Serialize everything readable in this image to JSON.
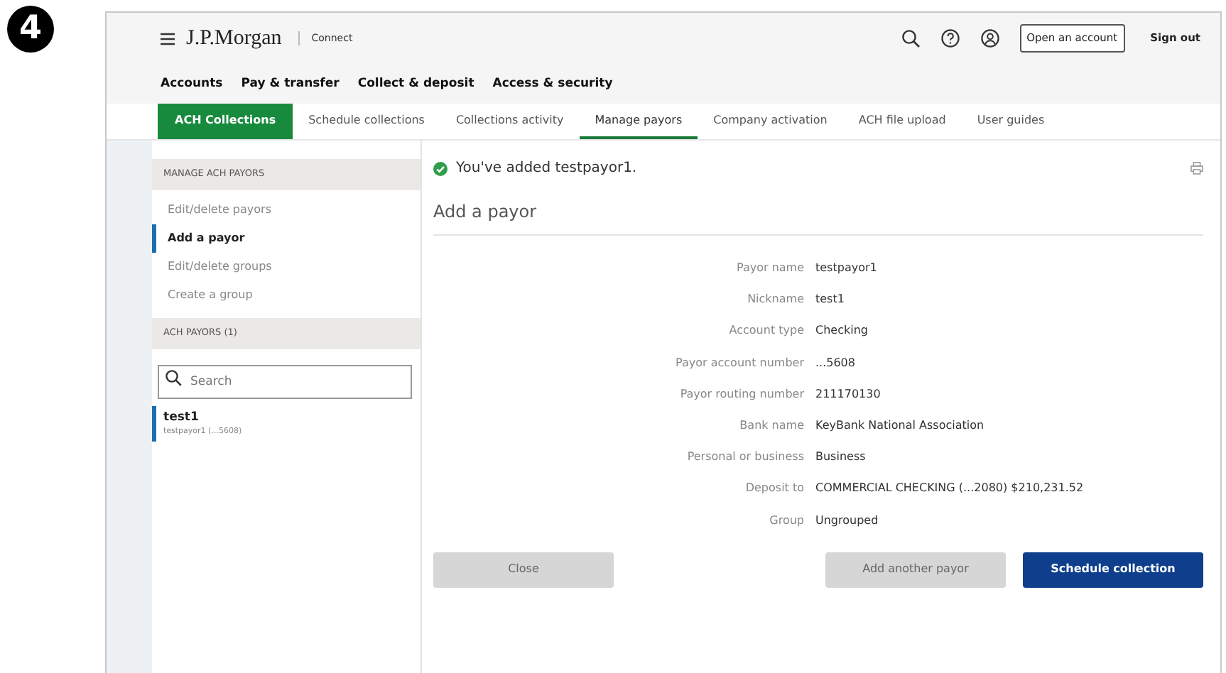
{
  "step_badge": "4",
  "header": {
    "brand": "J.P.Morgan",
    "product": "Connect",
    "open_account": "Open an account",
    "sign_out": "Sign out"
  },
  "main_nav": [
    "Accounts",
    "Pay & transfer",
    "Collect & deposit",
    "Access & security"
  ],
  "tabs": [
    {
      "label": "ACH Collections",
      "kind": "section",
      "selected": false
    },
    {
      "label": "Schedule collections",
      "kind": "tab",
      "selected": false
    },
    {
      "label": "Collections activity",
      "kind": "tab",
      "selected": false
    },
    {
      "label": "Manage payors",
      "kind": "tab",
      "selected": true
    },
    {
      "label": "Company activation",
      "kind": "tab",
      "selected": false
    },
    {
      "label": "ACH file upload",
      "kind": "tab",
      "selected": false
    },
    {
      "label": "User guides",
      "kind": "tab",
      "selected": false
    }
  ],
  "sidebar": {
    "heading": "MANAGE ACH PAYORS",
    "items": [
      {
        "label": "Edit/delete payors",
        "selected": false
      },
      {
        "label": "Add a payor",
        "selected": true
      },
      {
        "label": "Edit/delete groups",
        "selected": false
      },
      {
        "label": "Create a group",
        "selected": false
      }
    ],
    "payors_heading": "ACH PAYORS (1)",
    "search": {
      "placeholder": "Search"
    },
    "payors": [
      {
        "nickname": "test1",
        "detail": "testpayor1 (...5608)",
        "selected": true
      }
    ]
  },
  "main": {
    "success_message": "You've added testpayor1.",
    "title": "Add a payor",
    "details": [
      {
        "label": "Payor name",
        "value": "testpayor1"
      },
      {
        "label": "Nickname",
        "value": "test1"
      },
      {
        "label": "Account type",
        "value": "Checking"
      },
      {
        "label": "Payor account number",
        "value": "...5608"
      },
      {
        "label": "Payor routing number",
        "value": "211170130"
      },
      {
        "label": "Bank name",
        "value": "KeyBank National Association"
      },
      {
        "label": "Personal or business",
        "value": "Business"
      },
      {
        "label": "Deposit to",
        "value": "COMMERCIAL CHECKING (...2080) $210,231.52"
      },
      {
        "label": "Group",
        "value": "Ungrouped"
      }
    ],
    "buttons": [
      {
        "label": "Close",
        "kind": "secondary"
      },
      {
        "label": "Add another payor",
        "kind": "secondary"
      },
      {
        "label": "Schedule collection",
        "kind": "primary"
      }
    ]
  }
}
